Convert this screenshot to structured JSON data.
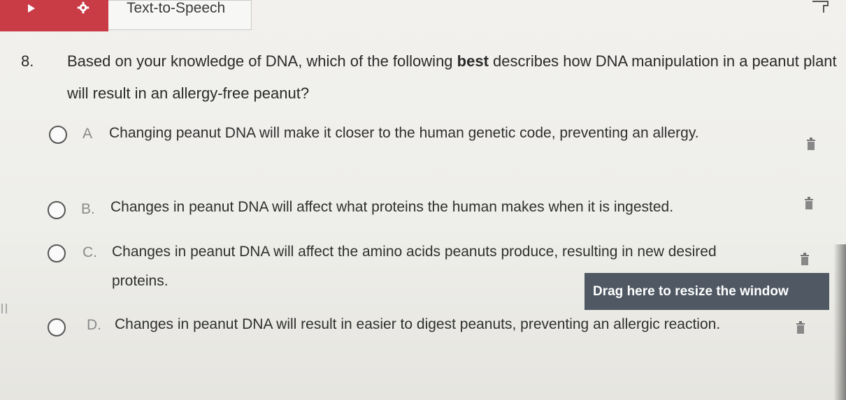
{
  "toolbar": {
    "play_icon": "play-icon",
    "settings_icon": "gear-icon",
    "label": "Text-to-Speech",
    "accent_color": "#c93b45"
  },
  "question": {
    "number": "8.",
    "text_before": "Based on your knowledge of DNA, which of the following ",
    "text_bold": "best",
    "text_after": " describes how DNA manipulation in a peanut plant will result in an allergy-free peanut?"
  },
  "options": [
    {
      "letter": "A",
      "text": "Changing peanut DNA will make it closer to the human genetic code, preventing an allergy."
    },
    {
      "letter": "B.",
      "text": "Changes in peanut DNA will affect what proteins the human makes when it is ingested."
    },
    {
      "letter": "C.",
      "text": "Changes in peanut DNA will affect the amino acids peanuts produce, resulting in new desired proteins."
    },
    {
      "letter": "D.",
      "text": "Changes in peanut DNA will result in easier to digest peanuts, preventing an allergic reaction."
    }
  ],
  "resize_handle": {
    "label": "Drag here to resize the window"
  }
}
